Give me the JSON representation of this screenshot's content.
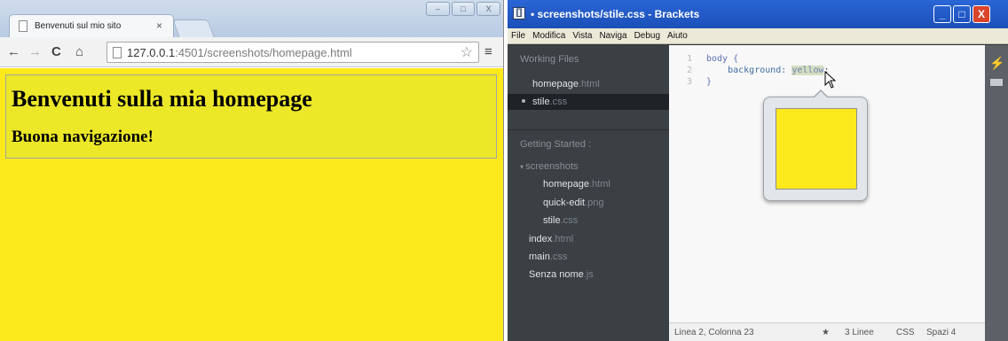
{
  "chrome": {
    "tab_title": "Benvenuti sul mio sito",
    "tab_close": "×",
    "url_host": "127.0.0.1",
    "url_rest": ":4501/screenshots/homepage.html",
    "nav_back": "←",
    "nav_forward": "→",
    "nav_reload": "C",
    "nav_home": "⌂",
    "star": "☆",
    "menu": "≡",
    "win_min": "–",
    "win_max": "□",
    "win_close": "X",
    "page_heading": "Benvenuti sulla mia homepage",
    "page_subheading": "Buona navigazione!",
    "page_background": "#fce91c"
  },
  "brackets": {
    "window_title": "• screenshots/stile.css - Brackets",
    "menu": [
      "File",
      "Modifica",
      "Vista",
      "Naviga",
      "Debug",
      "Aiuto"
    ],
    "sidebar": {
      "working_files_header": "Working Files",
      "working_files": [
        {
          "name": "homepage",
          "ext": ".html"
        },
        {
          "name": "stile",
          "ext": ".css"
        }
      ],
      "project_header": "Getting Started",
      "project_dropdown": ":",
      "tree": [
        {
          "name": "screenshots",
          "ext": "",
          "folder": true
        },
        {
          "name": "homepage",
          "ext": ".html"
        },
        {
          "name": "quick-edit",
          "ext": ".png"
        },
        {
          "name": "stile",
          "ext": ".css"
        },
        {
          "name": "index",
          "ext": ".html"
        },
        {
          "name": "main",
          "ext": ".css"
        },
        {
          "name": "Senza nome",
          "ext": ".js"
        }
      ]
    },
    "code": {
      "line_numbers": [
        "1",
        "2",
        "3"
      ],
      "l1_sel": "body",
      "l1_brace": "{",
      "l2_prop": "background:",
      "l2_val": "yellow",
      "l2_end": ";",
      "l3": "}"
    },
    "swatch_color": "#fce91c",
    "status": {
      "position": "Linea 2, Colonna 23",
      "star": "★",
      "lines": "3 Linee",
      "lang": "CSS",
      "spaces": "Spazi 4"
    }
  }
}
